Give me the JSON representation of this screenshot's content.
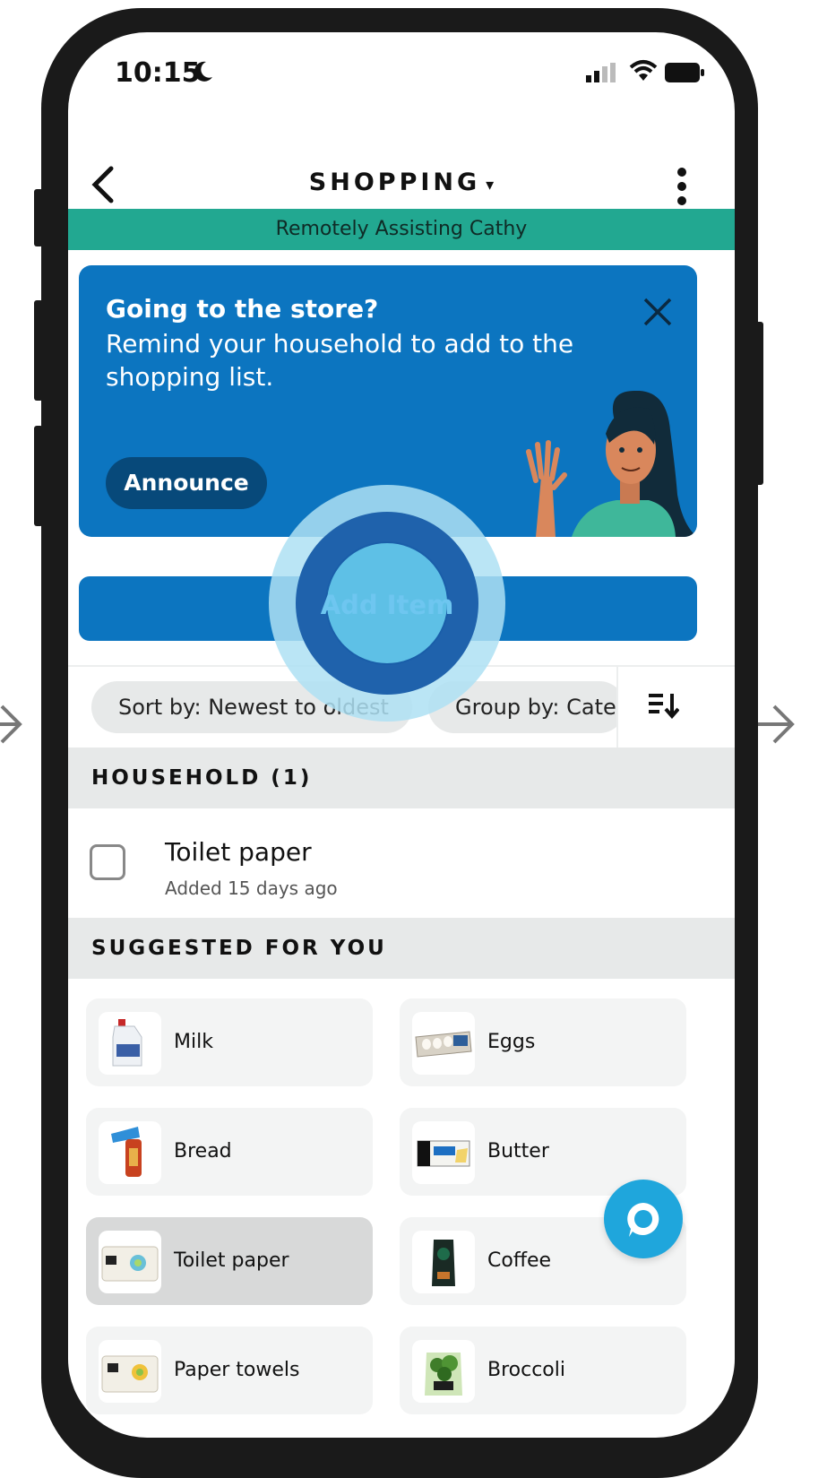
{
  "status_bar": {
    "time": "10:15"
  },
  "nav": {
    "title": "SHOPPING",
    "title_caret": "▾"
  },
  "assist_banner": "Remotely Assisting Cathy",
  "promo": {
    "title": "Going to the store?",
    "body": "Remind your household to add to the shopping list.",
    "button": "Announce"
  },
  "add_item": "Add Item",
  "sort_bar": {
    "sort_chip": "Sort by: Newest to oldest",
    "group_chip": "Group by: Category"
  },
  "household": {
    "header": "HOUSEHOLD (1)",
    "items": [
      {
        "name": "Toilet paper",
        "added": "Added 15 days ago",
        "checked": false
      }
    ]
  },
  "suggested": {
    "header": "SUGGESTED FOR YOU",
    "items": [
      {
        "label": "Milk",
        "icon": "milk-jug-icon"
      },
      {
        "label": "Eggs",
        "icon": "egg-carton-icon"
      },
      {
        "label": "Bread",
        "icon": "bread-icon"
      },
      {
        "label": "Butter",
        "icon": "butter-icon"
      },
      {
        "label": "Toilet paper",
        "icon": "toilet-paper-icon"
      },
      {
        "label": "Coffee",
        "icon": "coffee-bag-icon"
      },
      {
        "label": "Paper towels",
        "icon": "paper-towels-icon"
      },
      {
        "label": "Broccoli",
        "icon": "broccoli-icon"
      }
    ]
  },
  "colors": {
    "banner_green": "#22a891",
    "promo_blue": "#0c75c0",
    "button_dark": "#07497a",
    "fab_blue": "#1fa6dc"
  }
}
